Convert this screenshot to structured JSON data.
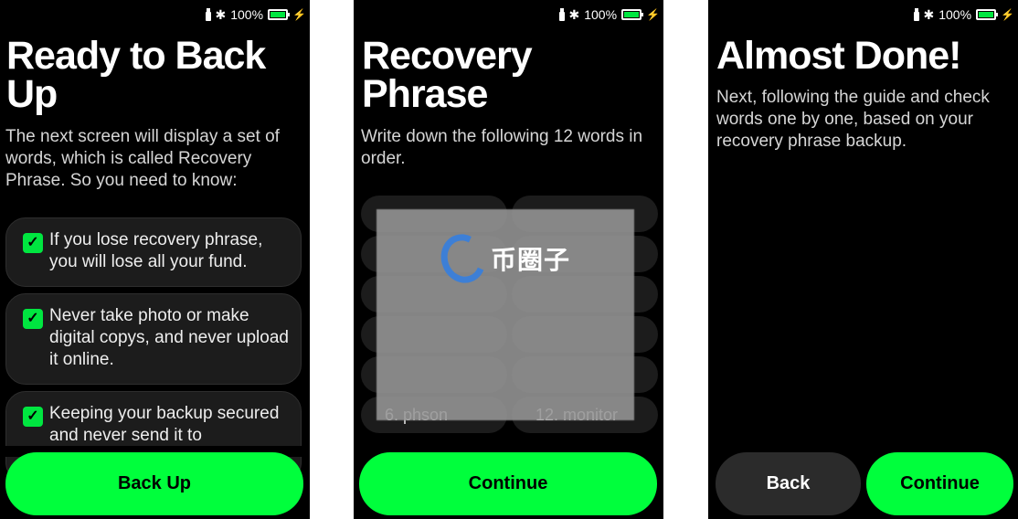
{
  "status_bar": {
    "battery_text": "100%",
    "battery_level": 1.0,
    "battery_color": "#00e640"
  },
  "screen1": {
    "title": "Ready to Back Up",
    "subtitle": "The next screen will display a set of words, which is called Recovery Phrase. So you need to know:",
    "items": [
      {
        "text": "If you lose recovery phrase, you will lose all your fund.",
        "checked": true
      },
      {
        "text": "Never take photo or make digital copys, and never upload it online.",
        "checked": true
      },
      {
        "text": "Keeping your backup secured and never send it to",
        "checked": true
      }
    ],
    "button_label": "Back Up"
  },
  "screen2": {
    "title": "Recovery Phrase",
    "subtitle": "Write down the following 12 words in order.",
    "words": [
      {
        "left": "",
        "right": ""
      },
      {
        "left": "",
        "right": ""
      },
      {
        "left": "",
        "right": ""
      },
      {
        "left": "",
        "right": ""
      },
      {
        "left": "",
        "right": ""
      },
      {
        "left": "6. phson",
        "right": "12. monitor"
      }
    ],
    "watermark": "币圈子",
    "button_label": "Continue"
  },
  "screen3": {
    "title": "Almost Done!",
    "subtitle": "Next, following the guide and check words one by one, based on your recovery phrase backup.",
    "back_label": "Back",
    "continue_label": "Continue"
  },
  "colors": {
    "accent": "#00ff3c",
    "background": "#000000",
    "card": "#1c1c1c"
  },
  "icons": [
    "usb-icon",
    "bluetooth-icon",
    "battery-icon",
    "charging-icon",
    "checkbox-checked-icon",
    "watermark-logo-icon"
  ]
}
